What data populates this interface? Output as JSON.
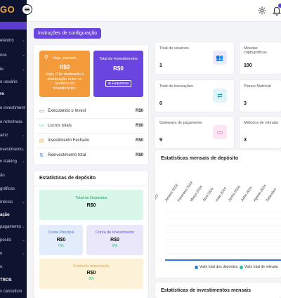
{
  "sidebar": {
    "brand": "GO",
    "items": [
      {
        "label": "elatório",
        "chev": true
      },
      {
        "label": "rios",
        "chev": true
      },
      {
        "label": "te",
        "chev": true
      },
      {
        "label": "o usuário",
        "chev": false
      },
      {
        "label": "ro",
        "chev": false,
        "hdr": true
      },
      {
        "label": "e investiment",
        "chev": false
      },
      {
        "label": "e referência",
        "chev": false
      },
      {
        "label": "atriz",
        "chev": true
      },
      {
        "label": "nvestimento",
        "chev": true
      },
      {
        "label": "n staking",
        "chev": true
      },
      {
        "label": "ão",
        "chev": false
      },
      {
        "label": "gráficas",
        "chev": false
      },
      {
        "label": "mércio",
        "chev": true
      },
      {
        "label": "ação",
        "chev": false,
        "hdr": true
      },
      {
        "label": "pagamento",
        "chev": true
      },
      {
        "label": "pósito",
        "chev": true
      },
      {
        "label": "e",
        "chev": true
      },
      {
        "label": "o",
        "chev": false
      },
      {
        "label": "TROS",
        "chev": false,
        "hdr": true
      },
      {
        "label": "s calcudism",
        "chev": false
      }
    ]
  },
  "header": {
    "config_button": "Instruções de configuração"
  },
  "balance": {
    "orange": {
      "title": "Hoje, alocado",
      "amount": "R$0",
      "desc_1": "Hoje, 0 foi destinado à",
      "desc_2": "distribuição entre os",
      "desc_3": "usuários do",
      "desc_4": "investimento."
    },
    "purple": {
      "title": "Total de Investimentos",
      "amount": "R$0",
      "button": "Esquemas"
    }
  },
  "stats": [
    {
      "label": "Executando o Invest",
      "value": "R$0"
    },
    {
      "label": "Lucros totais",
      "value": "R$0"
    },
    {
      "label": "Investimento Fechado",
      "value": "R$0"
    },
    {
      "label": "Reinvestimento total",
      "value": "R$0"
    }
  ],
  "deposit_stats": {
    "title": "Estatísticas de depósito",
    "total": {
      "label": "Total de Depósitos",
      "amount": "R$0"
    },
    "main_account": {
      "label": "Conta Principal",
      "amount": "R$0",
      "pct": "0%"
    },
    "investment_account": {
      "label": "Conta de Investimento",
      "amount": "R$0",
      "pct": "0%"
    },
    "negotiation": {
      "label": "Conta de negociação",
      "amount": "R$0",
      "pct": "0%"
    }
  },
  "metrics": [
    {
      "label": "Total de usuários",
      "value": "1"
    },
    {
      "label": "Moedas criptográficas",
      "value": "100"
    },
    {
      "label": "Total de transações",
      "value": "0"
    },
    {
      "label": "Planos Matricial",
      "value": "3"
    },
    {
      "label": "Gateways de pagamento",
      "value": "9"
    },
    {
      "label": "Métodos de retirada",
      "value": "3"
    }
  ],
  "deposit_chart": {
    "title": "Estatísticas mensais de depósito",
    "legend_deposits": "Valor total dos depósitos",
    "legend_withdrawals": "Valor total de retirada"
  },
  "chart_data": {
    "type": "line",
    "categories": [
      "2023",
      "Janeiro 2024",
      "Fevereiro 2024",
      "Março 2024",
      "Abril 2024",
      "maio 2024",
      "Junho 2024",
      "Julho 2024",
      "Agosto 2024",
      "Setembro"
    ],
    "series": [
      {
        "name": "Valor total dos depósitos",
        "color": "#2f7cd6",
        "values": [
          0,
          0,
          0,
          0,
          0,
          0,
          0,
          0,
          0,
          0
        ]
      },
      {
        "name": "Valor total de retirada",
        "color": "#1bbf9a",
        "values": [
          0,
          0,
          0,
          0,
          0,
          0,
          0,
          0,
          0,
          0
        ]
      }
    ]
  },
  "investment_chart": {
    "title": "Estatísticas de investimentos mensais"
  }
}
